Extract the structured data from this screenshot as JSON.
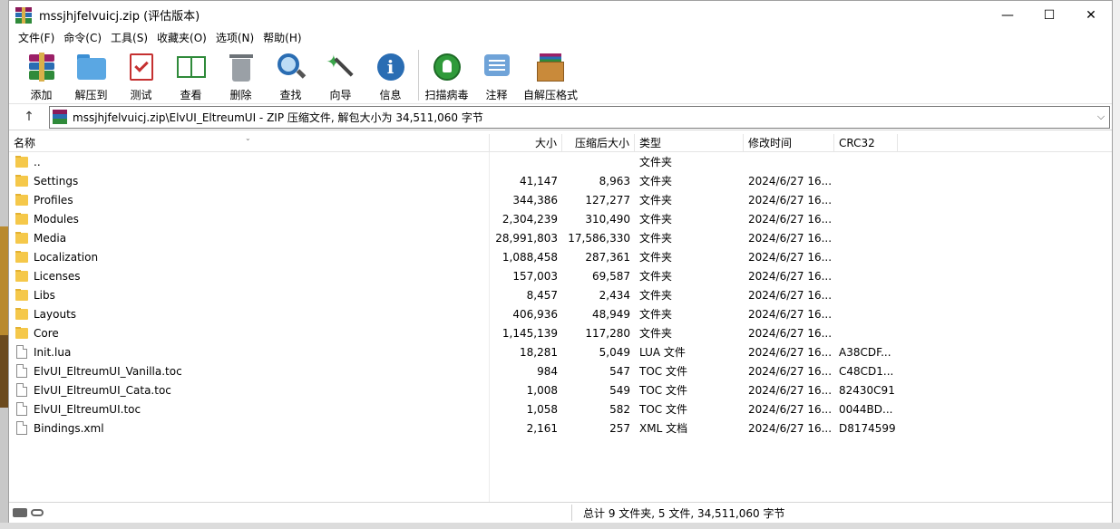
{
  "window": {
    "title": "mssjhjfelvuicj.zip (评估版本)",
    "controls": {
      "minimize": "—",
      "maximize": "☐",
      "close": "✕"
    }
  },
  "menu": [
    "文件(F)",
    "命令(C)",
    "工具(S)",
    "收藏夹(O)",
    "选项(N)",
    "帮助(H)"
  ],
  "toolbar": {
    "add": "添加",
    "extract": "解压到",
    "test": "测试",
    "view": "查看",
    "delete": "删除",
    "find": "查找",
    "wizard": "向导",
    "info": "信息",
    "scan": "扫描病毒",
    "comment": "注释",
    "sfx": "自解压格式"
  },
  "address": {
    "up": "↑",
    "path": "mssjhjfelvuicj.zip\\ElvUI_EltreumUI - ZIP 压缩文件, 解包大小为 34,511,060 字节",
    "dropdown": "⌵"
  },
  "columns": {
    "name": "名称",
    "size": "大小",
    "packed": "压缩后大小",
    "type": "类型",
    "modified": "修改时间",
    "crc": "CRC32",
    "sort_arrow": "⌄"
  },
  "files": [
    {
      "name": "..",
      "size": "",
      "packed": "",
      "type": "文件夹",
      "modified": "",
      "crc": "",
      "kind": "folder"
    },
    {
      "name": "Settings",
      "size": "41,147",
      "packed": "8,963",
      "type": "文件夹",
      "modified": "2024/6/27 16...",
      "crc": "",
      "kind": "folder"
    },
    {
      "name": "Profiles",
      "size": "344,386",
      "packed": "127,277",
      "type": "文件夹",
      "modified": "2024/6/27 16...",
      "crc": "",
      "kind": "folder"
    },
    {
      "name": "Modules",
      "size": "2,304,239",
      "packed": "310,490",
      "type": "文件夹",
      "modified": "2024/6/27 16...",
      "crc": "",
      "kind": "folder"
    },
    {
      "name": "Media",
      "size": "28,991,803",
      "packed": "17,586,330",
      "type": "文件夹",
      "modified": "2024/6/27 16...",
      "crc": "",
      "kind": "folder"
    },
    {
      "name": "Localization",
      "size": "1,088,458",
      "packed": "287,361",
      "type": "文件夹",
      "modified": "2024/6/27 16...",
      "crc": "",
      "kind": "folder"
    },
    {
      "name": "Licenses",
      "size": "157,003",
      "packed": "69,587",
      "type": "文件夹",
      "modified": "2024/6/27 16...",
      "crc": "",
      "kind": "folder"
    },
    {
      "name": "Libs",
      "size": "8,457",
      "packed": "2,434",
      "type": "文件夹",
      "modified": "2024/6/27 16...",
      "crc": "",
      "kind": "folder"
    },
    {
      "name": "Layouts",
      "size": "406,936",
      "packed": "48,949",
      "type": "文件夹",
      "modified": "2024/6/27 16...",
      "crc": "",
      "kind": "folder"
    },
    {
      "name": "Core",
      "size": "1,145,139",
      "packed": "117,280",
      "type": "文件夹",
      "modified": "2024/6/27 16...",
      "crc": "",
      "kind": "folder"
    },
    {
      "name": "Init.lua",
      "size": "18,281",
      "packed": "5,049",
      "type": "LUA 文件",
      "modified": "2024/6/27 16...",
      "crc": "A38CDF...",
      "kind": "file"
    },
    {
      "name": "ElvUI_EltreumUI_Vanilla.toc",
      "size": "984",
      "packed": "547",
      "type": "TOC 文件",
      "modified": "2024/6/27 16...",
      "crc": "C48CD1...",
      "kind": "file"
    },
    {
      "name": "ElvUI_EltreumUI_Cata.toc",
      "size": "1,008",
      "packed": "549",
      "type": "TOC 文件",
      "modified": "2024/6/27 16...",
      "crc": "82430C91",
      "kind": "file"
    },
    {
      "name": "ElvUI_EltreumUI.toc",
      "size": "1,058",
      "packed": "582",
      "type": "TOC 文件",
      "modified": "2024/6/27 16...",
      "crc": "0044BD...",
      "kind": "file"
    },
    {
      "name": "Bindings.xml",
      "size": "2,161",
      "packed": "257",
      "type": "XML 文档",
      "modified": "2024/6/27 16...",
      "crc": "D8174599",
      "kind": "xml"
    }
  ],
  "status": {
    "summary": "总计 9 文件夹, 5 文件, 34,511,060 字节"
  }
}
